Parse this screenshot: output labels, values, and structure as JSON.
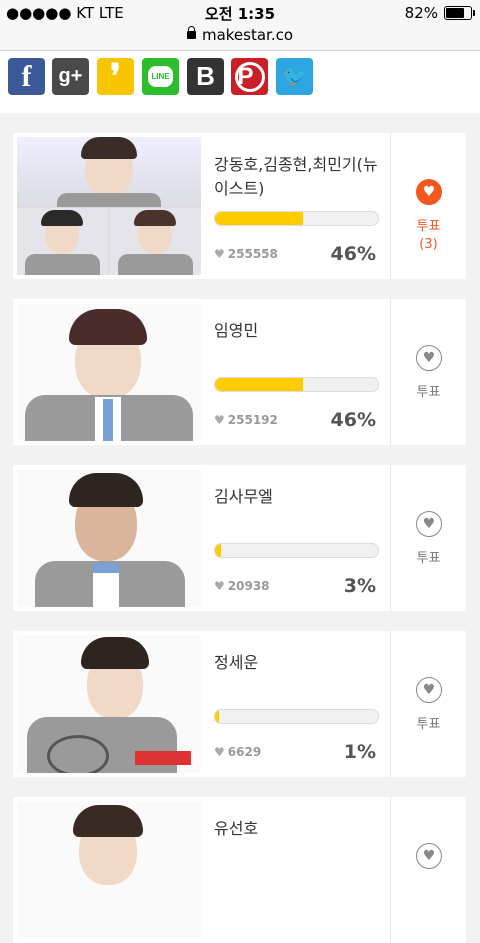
{
  "status": {
    "carrier": "●●●●● KT  LTE",
    "time": "오전 1:35",
    "battery": "82%",
    "battery_fraction": 0.82
  },
  "url": "makestar.co",
  "share": [
    {
      "name": "facebook-icon",
      "glyph": "f",
      "color": "#3b5998"
    },
    {
      "name": "google-plus-icon",
      "glyph": "g+",
      "color": "#4a4a4a"
    },
    {
      "name": "kakaostory-icon",
      "glyph": "❜",
      "color": "#f9c500"
    },
    {
      "name": "line-icon",
      "glyph": "LINE",
      "color": "#2dbd2d"
    },
    {
      "name": "band-icon",
      "glyph": "B",
      "color": "#333333"
    },
    {
      "name": "pinterest-icon",
      "glyph": "P",
      "color": "#cb1f27"
    },
    {
      "name": "twitter-icon",
      "glyph": "🐦",
      "color": "#2ca5e0"
    }
  ],
  "cards": [
    {
      "name": "강동호,김종현,최민기(뉴이스트)",
      "votes": "255558",
      "percent": "46%",
      "fraction": 0.46,
      "vote_label": "투표",
      "vote_count": "(3)",
      "active": true
    },
    {
      "name": "임영민",
      "votes": "255192",
      "percent": "46%",
      "fraction": 0.46,
      "vote_label": "투표",
      "vote_count": "",
      "active": false
    },
    {
      "name": "김사무엘",
      "votes": "20938",
      "percent": "3%",
      "fraction": 0.03,
      "vote_label": "투표",
      "vote_count": "",
      "active": false
    },
    {
      "name": "정세운",
      "votes": "6629",
      "percent": "1%",
      "fraction": 0.01,
      "vote_label": "투표",
      "vote_count": "",
      "active": false
    },
    {
      "name": "유선호",
      "votes": "",
      "percent": "",
      "fraction": 0,
      "vote_label": "",
      "vote_count": "",
      "active": false
    }
  ]
}
